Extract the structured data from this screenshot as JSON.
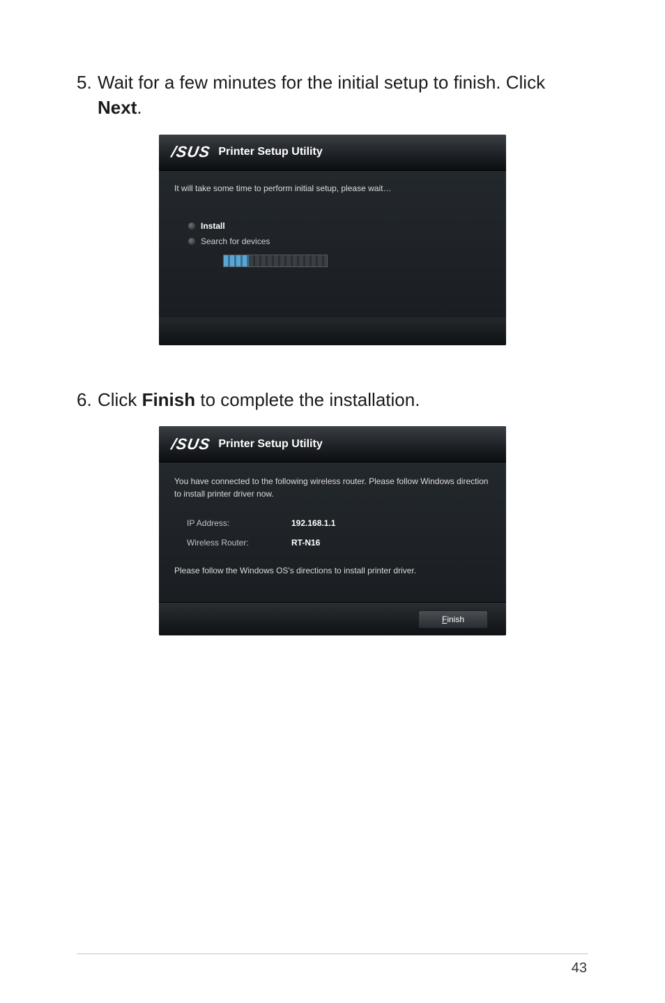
{
  "steps": {
    "s5": {
      "num": "5.",
      "text_pre": "Wait for a few minutes for the initial setup to finish. Click ",
      "text_bold": "Next",
      "text_post": "."
    },
    "s6": {
      "num": "6.",
      "text_pre": "Click ",
      "text_bold": "Finish",
      "text_post": " to complete the installation."
    }
  },
  "dialog1": {
    "brand": "/SUS",
    "title": "Printer Setup Utility",
    "wait": "It will take some time to perform initial setup, please wait…",
    "install": "Install",
    "search": "Search for devices"
  },
  "dialog2": {
    "brand": "/SUS",
    "title": "Printer Setup Utility",
    "connected": "You have connected to the following wireless router. Please follow Windows direction to install printer driver now.",
    "ip_label": "IP Address:",
    "ip_value": "192.168.1.1",
    "router_label": "Wireless Router:",
    "router_value": "RT-N16",
    "follow": "Please follow the Windows OS's directions to install printer driver.",
    "finish_u": "F",
    "finish_rest": "inish"
  },
  "page_number": "43"
}
